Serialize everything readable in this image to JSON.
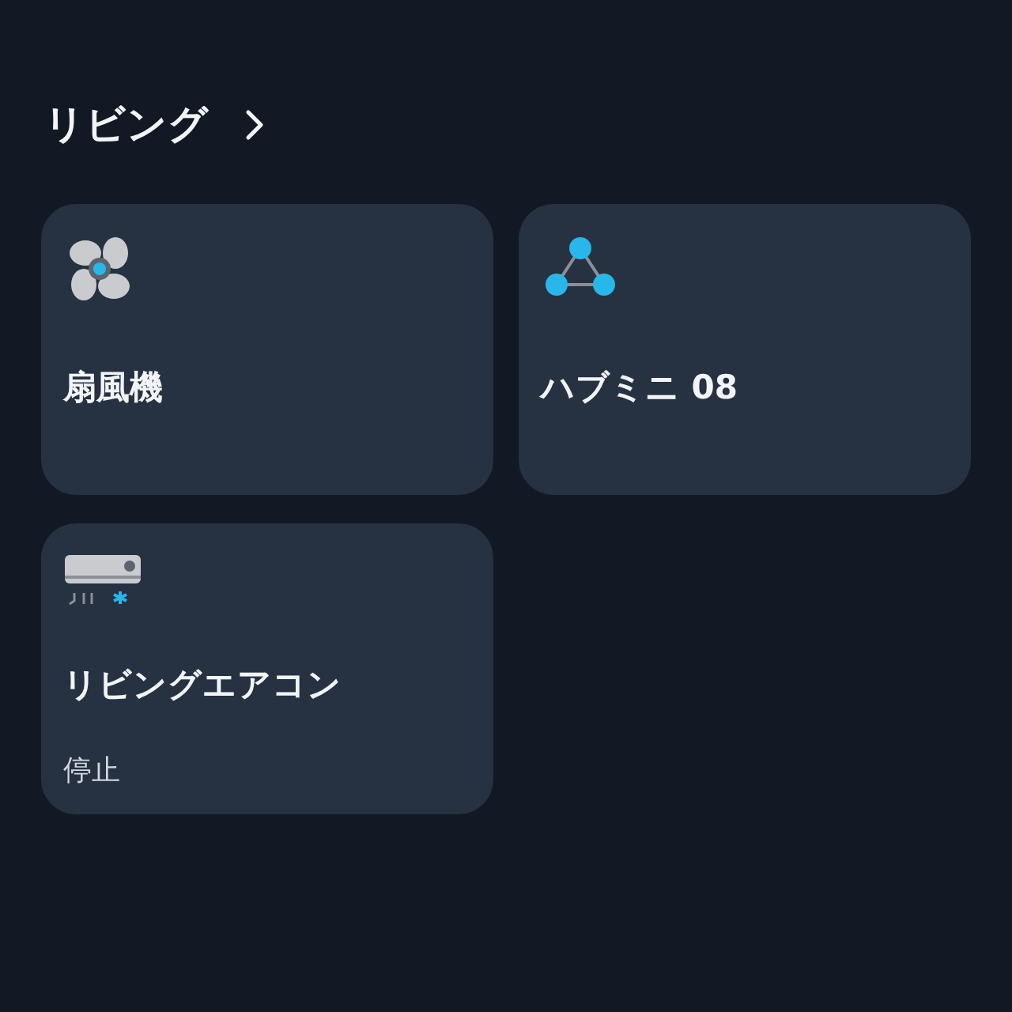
{
  "room": {
    "title": "リビング"
  },
  "devices": [
    {
      "kind": "fan",
      "name": "扇風機"
    },
    {
      "kind": "hub",
      "name": "ハブミニ 08"
    },
    {
      "kind": "aircon",
      "name": "リビングエアコン",
      "status": "停止"
    }
  ]
}
